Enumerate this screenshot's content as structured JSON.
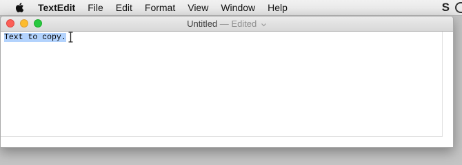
{
  "menubar": {
    "items": [
      "TextEdit",
      "File",
      "Edit",
      "Format",
      "View",
      "Window",
      "Help"
    ],
    "status_letter": "S"
  },
  "window": {
    "title": "Untitled",
    "separator": "—",
    "status": "Edited"
  },
  "document": {
    "text": "Text to copy."
  },
  "icons": {
    "apple": "apple-logo-icon",
    "chevron": "chevron-down-icon",
    "cursor": "text-cursor-ibeam-icon"
  },
  "colors": {
    "close": "#fc5f57",
    "minimize": "#fdbc2e",
    "maximize": "#27c840",
    "selection": "#b3d3fd"
  }
}
